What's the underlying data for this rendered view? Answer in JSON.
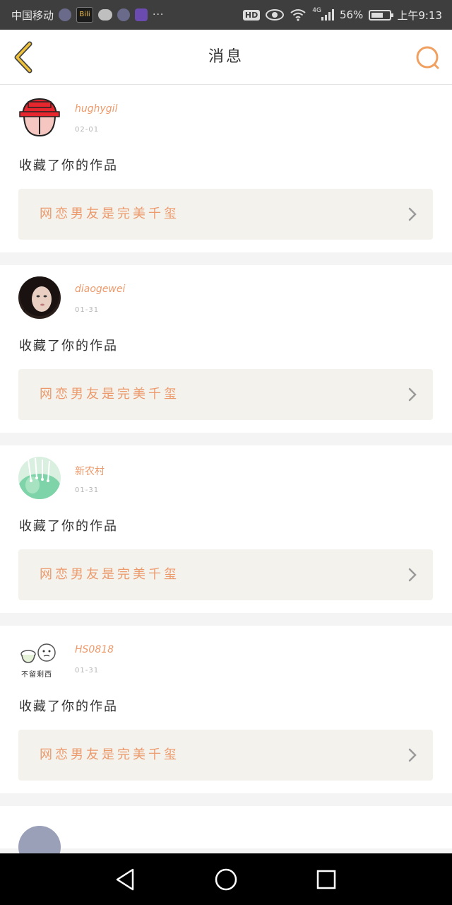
{
  "status_bar": {
    "carrier": "中国移动",
    "app_icons": [
      "settings-icon",
      "bili-icon",
      "wechat-icon",
      "qq-icon",
      "app-icon"
    ],
    "bili_text": "Bili",
    "more": "···",
    "hd": "HD",
    "network": "4G",
    "battery": "56%",
    "time": "上午9:13"
  },
  "header": {
    "title": "消息",
    "back_icon": "chevron-left-icon",
    "search_icon": "search-icon",
    "accent_color": "#f0a060"
  },
  "messages": [
    {
      "username": "hughygil",
      "time": "02-01",
      "action": "收藏了你的作品",
      "work_title": "网恋男友是完美千玺",
      "avatar": "red-cartoon-avatar"
    },
    {
      "username": "diaogewei",
      "time": "01-31",
      "action": "收藏了你的作品",
      "work_title": "网恋男友是完美千玺",
      "avatar": "girl-photo-avatar"
    },
    {
      "username": "新农村",
      "time": "01-31",
      "action": "收藏了你的作品",
      "work_title": "网恋男友是完美千玺",
      "avatar": "green-flower-avatar"
    },
    {
      "username": "HS0818",
      "time": "01-31",
      "action": "收藏了你的作品",
      "work_title": "网恋男友是完美千玺",
      "avatar": "sketch-avatar",
      "avatar_text": "不留剩西"
    }
  ],
  "colors": {
    "accent": "#ec9a6c",
    "work_box_bg": "#f3f2ed"
  },
  "nav": [
    "back-nav-icon",
    "home-nav-icon",
    "recents-nav-icon"
  ]
}
